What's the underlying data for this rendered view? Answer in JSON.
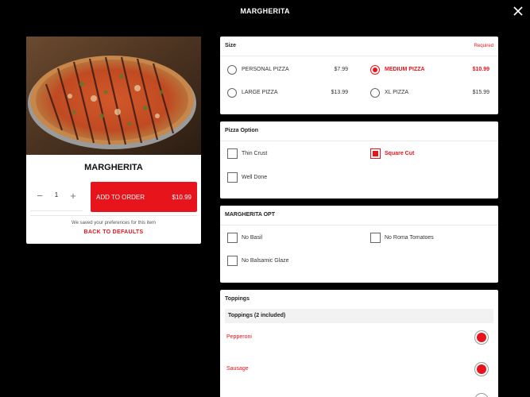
{
  "header": {
    "title": "MARGHERITA"
  },
  "item": {
    "name": "MARGHERITA",
    "quantity": "1",
    "add_label": "ADD TO ORDER",
    "add_price": "$10.99",
    "saved_note": "We saved your preferences for this item",
    "defaults_label": "BACK TO DEFAULTS"
  },
  "size": {
    "title": "Size",
    "required": "Required",
    "options": [
      {
        "label": "PERSONAL PIZZA",
        "price": "$7.99",
        "selected": false
      },
      {
        "label": "MEDIUM PIZZA",
        "price": "$10.99",
        "selected": true
      },
      {
        "label": "LARGE PIZZA",
        "price": "$13.99",
        "selected": false
      },
      {
        "label": "XL PIZZA",
        "price": "$15.99",
        "selected": false
      }
    ]
  },
  "pizza_option": {
    "title": "Pizza Option",
    "options": [
      {
        "label": "Thin Crust",
        "selected": false
      },
      {
        "label": "Square Cut",
        "selected": true
      },
      {
        "label": "Well Done",
        "selected": false
      }
    ]
  },
  "margherita_opt": {
    "title": "MARGHERITA OPT",
    "options": [
      {
        "label": "No Basil",
        "selected": false
      },
      {
        "label": "No Roma Tomatoes",
        "selected": false
      },
      {
        "label": "No Balsamic Glaze",
        "selected": false
      }
    ]
  },
  "toppings": {
    "title": "Toppings",
    "subtitle": "Toppings (2 included)",
    "items": [
      {
        "label": "Pepperoni",
        "selected": true
      },
      {
        "label": "Sausage",
        "selected": true
      }
    ]
  },
  "colors": {
    "accent": "#e8141b",
    "background": "#000000"
  }
}
